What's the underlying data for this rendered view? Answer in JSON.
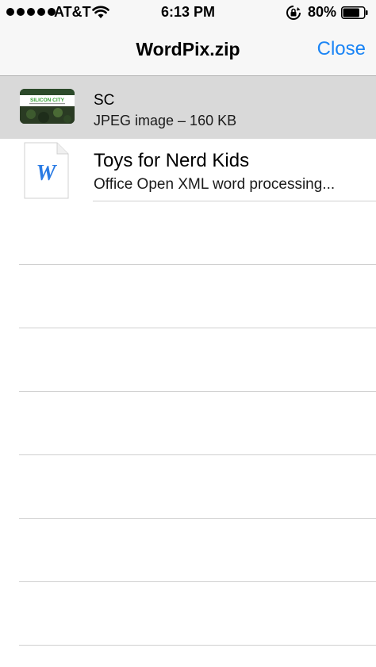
{
  "status_bar": {
    "carrier": "AT&T",
    "time": "6:13 PM",
    "battery_percent": "80%",
    "battery_level": 0.8,
    "icons": [
      "signal-dots-icon",
      "wifi-icon",
      "orientation-lock-icon",
      "battery-icon"
    ]
  },
  "nav": {
    "title": "WordPix.zip",
    "close_label": "Close"
  },
  "files": [
    {
      "name": "SC",
      "detail": "JPEG image – 160 KB",
      "icon": "jpeg-thumbnail",
      "thumbnail_text": "SILICON CITY",
      "selected": true
    },
    {
      "name": "Toys for Nerd Kids",
      "detail": "Office Open XML word processing...",
      "icon": "word-document-icon",
      "icon_letter": "W",
      "selected": false
    }
  ],
  "colors": {
    "accent": "#1a84f5",
    "bar_background": "#f7f7f7",
    "selected_row": "#d9d9d9",
    "separator": "#d0d0d0"
  }
}
